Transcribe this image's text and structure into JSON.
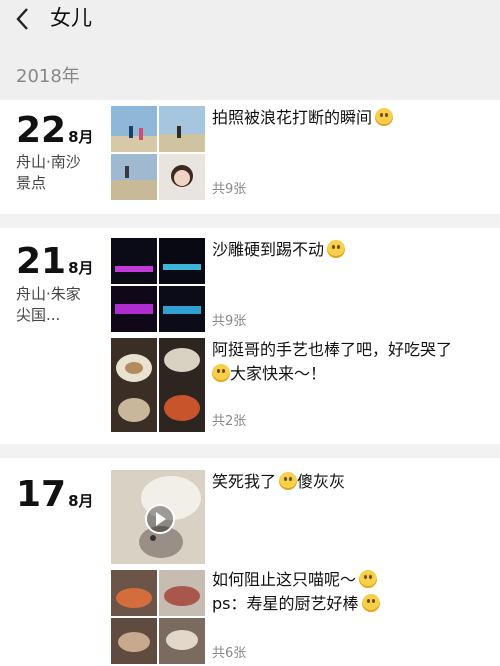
{
  "header": {
    "title": "女儿",
    "year": "2018年"
  },
  "posts": [
    {
      "day": "22",
      "month": "8月",
      "location": "舟山·南沙景点",
      "caption": "拍照被浪花打断的瞬间",
      "count": "共9张"
    },
    {
      "day": "21",
      "month": "8月",
      "location": "舟山·朱家尖国...",
      "caption": "沙雕硬到踢不动",
      "count": "共9张"
    },
    {
      "caption": "阿挺哥的手艺也棒了吧，好吃哭了",
      "caption2": "大家快来～！",
      "count": "共2张"
    },
    {
      "day": "17",
      "month": "8月",
      "caption": "笑死我了",
      "caption_tail": "傻灰灰"
    },
    {
      "caption": "如何阻止这只喵呢～",
      "caption2": "ps：寿星的厨艺好棒",
      "count": "共6张"
    }
  ],
  "icons": {
    "back": "back-arrow-icon",
    "play": "play-icon"
  }
}
